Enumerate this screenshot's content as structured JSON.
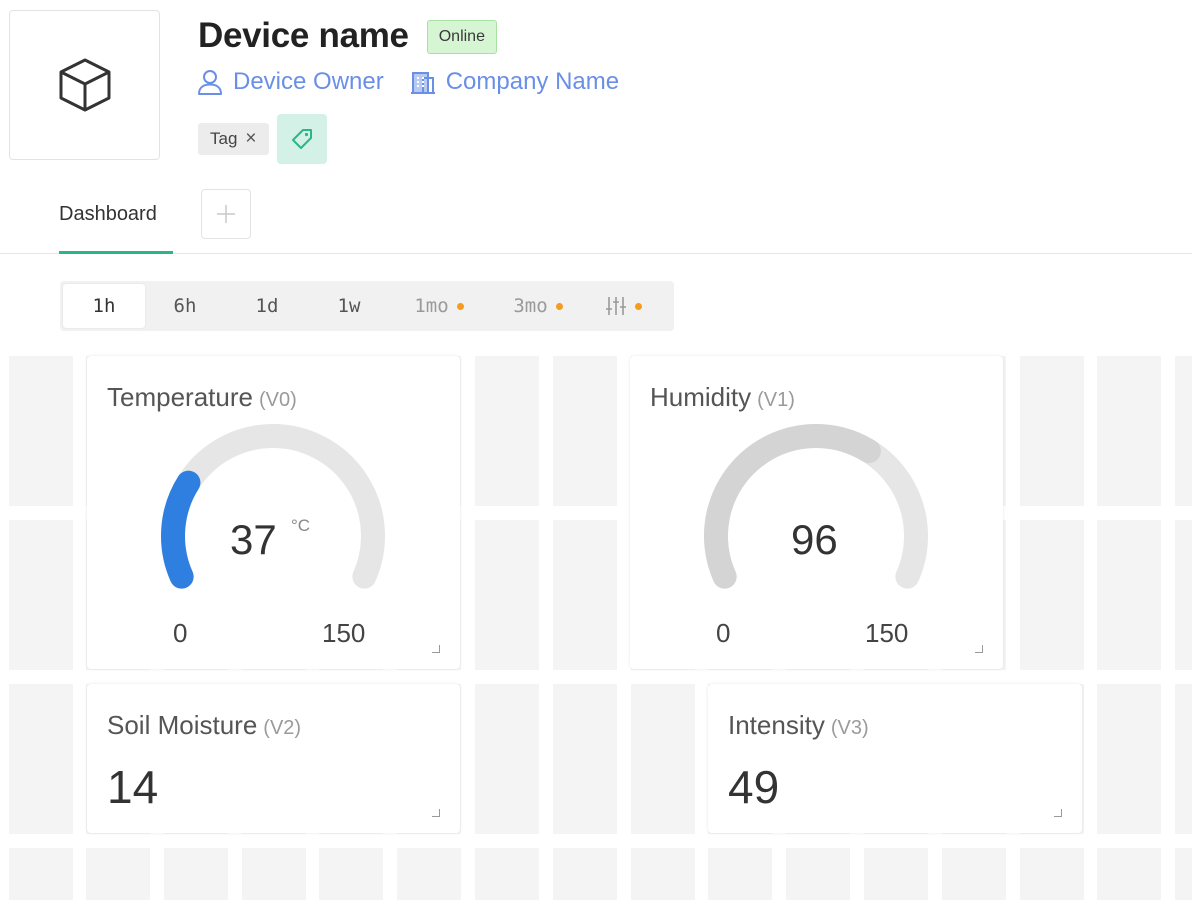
{
  "device": {
    "name": "Device name",
    "status": "Online",
    "owner": "Device Owner",
    "company": "Company Name",
    "tags": [
      {
        "label": "Tag"
      }
    ]
  },
  "tabs": [
    {
      "label": "Dashboard",
      "active": true
    }
  ],
  "time_ranges": [
    {
      "label": "1h",
      "active": true,
      "indicator": false
    },
    {
      "label": "6h",
      "active": false,
      "indicator": false
    },
    {
      "label": "1d",
      "active": false,
      "indicator": false
    },
    {
      "label": "1w",
      "active": false,
      "indicator": false
    },
    {
      "label": "1mo",
      "active": false,
      "indicator": true
    },
    {
      "label": "3mo",
      "active": false,
      "indicator": true
    },
    {
      "label": "",
      "icon": "sliders-icon",
      "active": false,
      "indicator": true
    }
  ],
  "widgets": {
    "temperature": {
      "title": "Temperature",
      "pin": "(V0)",
      "value": "37",
      "value_num": 37,
      "unit": "°C",
      "min": "0",
      "max": "150",
      "min_num": 0,
      "max_num": 150
    },
    "humidity": {
      "title": "Humidity",
      "pin": "(V1)",
      "value": "96",
      "value_num": 96,
      "min": "0",
      "max": "150",
      "min_num": 0,
      "max_num": 150
    },
    "soil": {
      "title": "Soil Moisture",
      "pin": "(V2)",
      "value": "14"
    },
    "intensity": {
      "title": "Intensity",
      "pin": "(V3)",
      "value": "49"
    }
  },
  "colors": {
    "accent": "#2bb68a",
    "link": "#6a8fe6",
    "gauge_fill_temperature": "#2f7fe0",
    "gauge_fill_humidity": "#d4d4d4",
    "gauge_track": "#e6e6e6",
    "indicator_dot": "#f39c1f",
    "online_badge": "#d6f5d3"
  }
}
